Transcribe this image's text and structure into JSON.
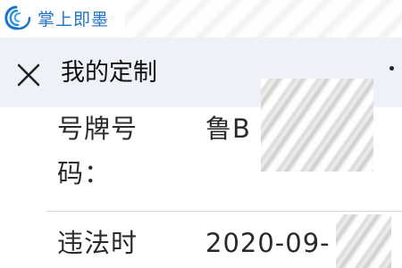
{
  "watermark": {
    "text": "掌上即墨",
    "icon": "wave-logo-icon",
    "color": "#1d73c9"
  },
  "header": {
    "close_icon": "close-icon",
    "title": "我的定制",
    "more_icon": "more-dot-icon",
    "background": "#eef2f8"
  },
  "fields": [
    {
      "label_line1": "号牌号",
      "label_line2": "码：",
      "value": "鲁B"
    },
    {
      "label_line1": "违法时",
      "value": "2020-09-"
    }
  ]
}
